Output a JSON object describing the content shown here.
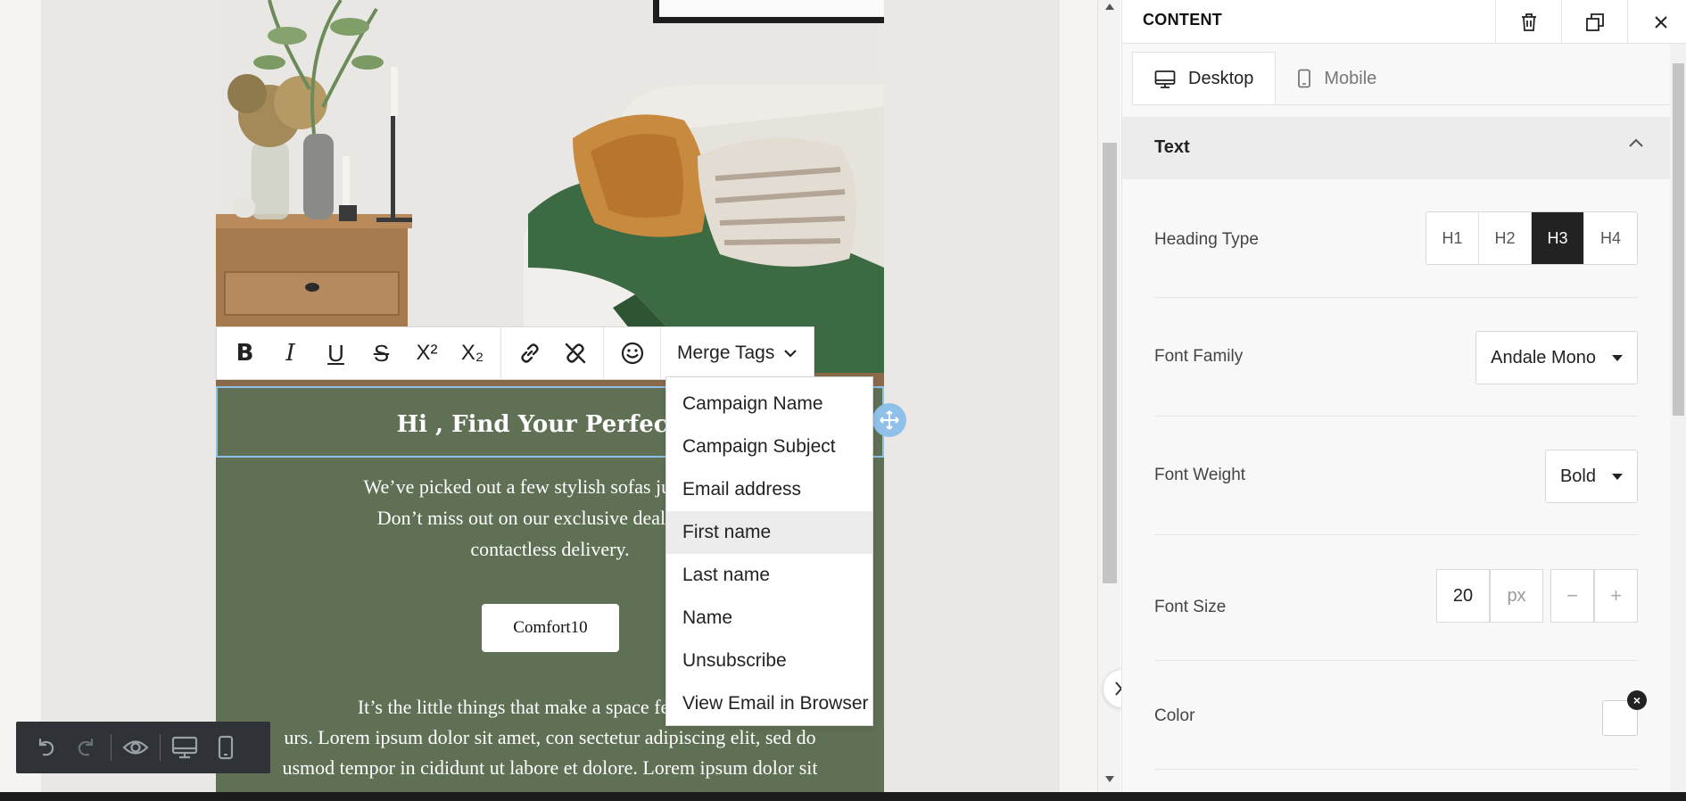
{
  "email": {
    "heading": "Hi , Find Your Perfect S",
    "body_lines": [
      "We’ve picked out a few stylish sofas just for yo",
      "Don’t miss out on our exclusive deals! Save",
      "contactless delivery."
    ],
    "button_label": "Comfort10",
    "body2_lines": [
      "It’s the little things that make a space feel like ho",
      "urs. Lorem ipsum dolor sit amet, con sectetur adipiscing elit, sed do",
      "usmod tempor in cididunt ut labore et dolore. Lorem ipsum dolor sit"
    ]
  },
  "format_toolbar": {
    "bold": "B",
    "italic": "I",
    "underline": "U",
    "strike": "S",
    "superscript": "X²",
    "subscript": "X₂",
    "merge_tags_label": "Merge Tags"
  },
  "merge_menu": {
    "items": [
      "Campaign Name",
      "Campaign Subject",
      "Email address",
      "First name",
      "Last name",
      "Name",
      "Unsubscribe",
      "View Email in Browser"
    ],
    "hovered": "First name"
  },
  "panel": {
    "title": "CONTENT",
    "tabs": {
      "desktop": "Desktop",
      "mobile": "Mobile"
    },
    "section_title": "Text",
    "heading_type": {
      "label": "Heading Type",
      "options": [
        "H1",
        "H2",
        "H3",
        "H4"
      ],
      "selected": "H3"
    },
    "font_family": {
      "label": "Font Family",
      "value": "Andale Mono"
    },
    "font_weight": {
      "label": "Font Weight",
      "value": "Bold"
    },
    "font_size": {
      "label": "Font Size",
      "value": "20",
      "unit": "px",
      "minus": "−",
      "plus": "+"
    },
    "color": {
      "label": "Color",
      "clear": "×",
      "value": "#ffffff"
    }
  },
  "colors": {
    "email_bg": "#5f7055",
    "selection": "#8ec0ea",
    "dock_bg": "#2f3237",
    "active_heading": "#222222"
  }
}
